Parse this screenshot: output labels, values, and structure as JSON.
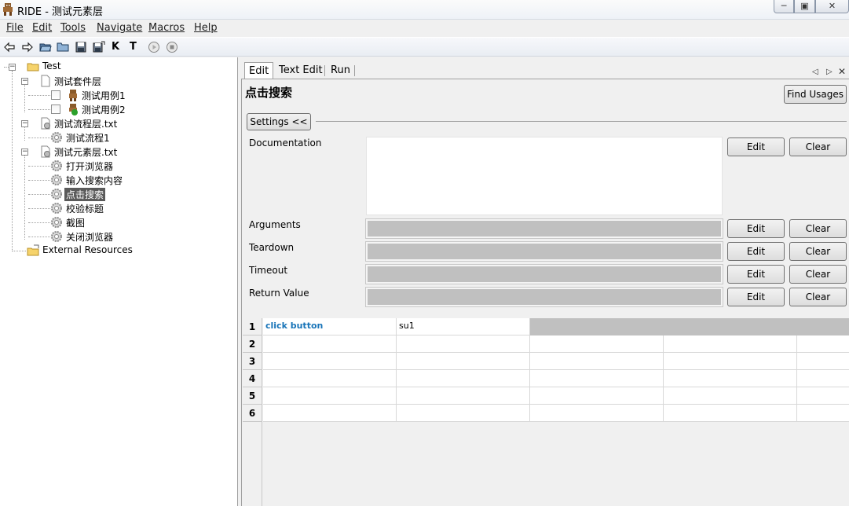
{
  "window": {
    "title": "RIDE - 测试元素层",
    "controls": [
      "minimize-icon",
      "maximize-icon",
      "close-icon"
    ]
  },
  "menu": {
    "items": [
      {
        "label": "File"
      },
      {
        "label": "Edit"
      },
      {
        "label": "Tools"
      },
      {
        "label": "Navigate"
      },
      {
        "label": "Macros"
      },
      {
        "label": "Help"
      }
    ]
  },
  "toolbar": {
    "icons": [
      "back-arrow-icon",
      "forward-arrow-icon",
      "open-folder-icon",
      "folder-icon",
      "save-icon",
      "save-all-icon",
      "keyword-search-icon",
      "test-search-icon",
      "run-icon",
      "stop-icon"
    ],
    "keyword_search_glyph": "K",
    "test_search_glyph": "T"
  },
  "tree": {
    "root": "Test",
    "suite": "测试套件层",
    "tests": [
      "测试用例1",
      "测试用例2"
    ],
    "flow_file": "测试流程层.txt",
    "flow_keywords": [
      "测试流程1"
    ],
    "element_file": "测试元素层.txt",
    "element_keywords": [
      "打开浏览器",
      "输入搜索内容",
      "点击搜索",
      "校验标题",
      "截图",
      "关闭浏览器"
    ],
    "selected": "点击搜索",
    "external": "External Resources"
  },
  "tabs": [
    {
      "label": "Edit",
      "active": true
    },
    {
      "label": "Text Edit",
      "active": false
    },
    {
      "label": "Run",
      "active": false
    }
  ],
  "editor": {
    "keyword_name": "点击搜索",
    "find_usages": "Find Usages",
    "settings_toggle": "Settings <<",
    "fields": [
      {
        "label": "Documentation",
        "edit": "Edit",
        "clear": "Clear"
      },
      {
        "label": "Arguments",
        "edit": "Edit",
        "clear": "Clear"
      },
      {
        "label": "Teardown",
        "edit": "Edit",
        "clear": "Clear"
      },
      {
        "label": "Timeout",
        "edit": "Edit",
        "clear": "Clear"
      },
      {
        "label": "Return Value",
        "edit": "Edit",
        "clear": "Clear"
      }
    ]
  },
  "grid": {
    "rows": [
      {
        "num": "1",
        "cells": [
          "click button",
          "su1"
        ]
      },
      {
        "num": "2",
        "cells": [
          "",
          ""
        ]
      },
      {
        "num": "3",
        "cells": [
          "",
          ""
        ]
      },
      {
        "num": "4",
        "cells": [
          "",
          ""
        ]
      },
      {
        "num": "5",
        "cells": [
          "",
          ""
        ]
      },
      {
        "num": "6",
        "cells": [
          "",
          ""
        ]
      }
    ]
  },
  "colors": {
    "keyword_text": "#1874b8",
    "selected_bg": "#5a5a5a",
    "disabled_field": "#c0c0c0"
  }
}
